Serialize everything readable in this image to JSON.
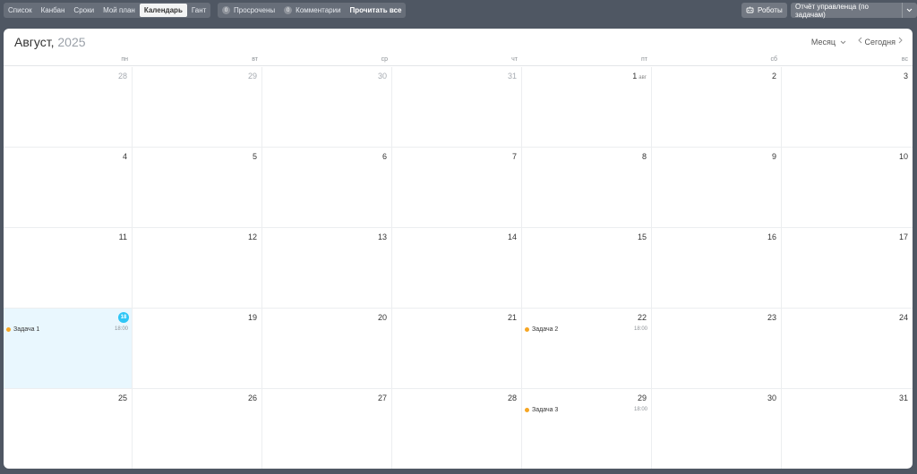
{
  "toolbar": {
    "views": [
      {
        "label": "Список",
        "active": false
      },
      {
        "label": "Канбан",
        "active": false
      },
      {
        "label": "Сроки",
        "active": false
      },
      {
        "label": "Мой план",
        "active": false
      },
      {
        "label": "Календарь",
        "active": true
      },
      {
        "label": "Гант",
        "active": false
      }
    ],
    "overdue": {
      "count": "0",
      "label": "Просрочены"
    },
    "comments": {
      "count": "0",
      "label": "Комментарии"
    },
    "read_all": "Прочитать все",
    "robots": "Роботы",
    "report": "Отчёт управленца (по задачам)"
  },
  "calendar": {
    "month": "Август,",
    "year": "2025",
    "view_select": "Месяц",
    "today_label": "Сегодня",
    "weekdays": [
      "пн",
      "вт",
      "ср",
      "чт",
      "пт",
      "сб",
      "вс"
    ],
    "days": [
      {
        "num": "28",
        "muted": true
      },
      {
        "num": "29",
        "muted": true
      },
      {
        "num": "30",
        "muted": true
      },
      {
        "num": "31",
        "muted": true
      },
      {
        "num": "1",
        "month": "авг"
      },
      {
        "num": "2"
      },
      {
        "num": "3"
      },
      {
        "num": "4"
      },
      {
        "num": "5"
      },
      {
        "num": "6"
      },
      {
        "num": "7"
      },
      {
        "num": "8"
      },
      {
        "num": "9"
      },
      {
        "num": "10"
      },
      {
        "num": "11"
      },
      {
        "num": "12"
      },
      {
        "num": "13"
      },
      {
        "num": "14"
      },
      {
        "num": "15"
      },
      {
        "num": "16"
      },
      {
        "num": "17"
      },
      {
        "num": "18",
        "today": true,
        "event": {
          "name": "Задача 1",
          "time": "18:00"
        }
      },
      {
        "num": "19"
      },
      {
        "num": "20"
      },
      {
        "num": "21"
      },
      {
        "num": "22",
        "event": {
          "name": "Задача 2",
          "time": "18:00"
        }
      },
      {
        "num": "23"
      },
      {
        "num": "24"
      },
      {
        "num": "25"
      },
      {
        "num": "26"
      },
      {
        "num": "27"
      },
      {
        "num": "28"
      },
      {
        "num": "29",
        "event": {
          "name": "Задача 3",
          "time": "18:00"
        }
      },
      {
        "num": "30"
      },
      {
        "num": "31"
      }
    ]
  },
  "colors": {
    "today_badge": "#2fc6f6",
    "today_bg": "#e9f7fe",
    "event_dot": "#f6a623",
    "background": "#4f5763"
  }
}
